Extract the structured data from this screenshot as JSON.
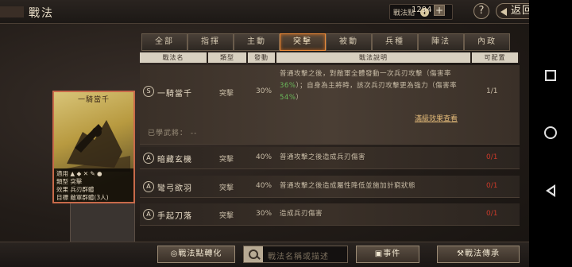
{
  "header": {
    "title": "戰法",
    "points_label": "戰法點",
    "points_icon": "coin-icon",
    "points_value": "1294",
    "plus_label": "+",
    "help_label": "?",
    "back_label": "返回"
  },
  "tabs": [
    {
      "label": "全部",
      "active": false
    },
    {
      "label": "指揮",
      "active": false
    },
    {
      "label": "主動",
      "active": false
    },
    {
      "label": "突擊",
      "active": true
    },
    {
      "label": "被動",
      "active": false
    },
    {
      "label": "兵種",
      "active": false
    },
    {
      "label": "陣法",
      "active": false
    },
    {
      "label": "內政",
      "active": false
    }
  ],
  "columns": [
    "戰法名",
    "類型",
    "發動",
    "戰法說明",
    "可配置"
  ],
  "featured": {
    "grade": "S",
    "name": "一騎當千",
    "type": "突擊",
    "rate": "30%",
    "desc_part1": "普通攻擊之後，對敵軍全體發動一次兵刃攻擊（傷害率",
    "desc_hl1": "36%",
    "desc_part2": "）；自身為主將時，該次兵刃攻擊更為強力（傷害率",
    "desc_hl2": "54%",
    "desc_part3": "）",
    "avail": "1/1",
    "effect_link": "滿級效果查看",
    "learned": "已學武將： --"
  },
  "rows": [
    {
      "grade": "A",
      "name": "暗藏玄機",
      "type": "突擊",
      "rate": "40%",
      "desc": "普通攻擊之後造成兵刃傷害",
      "avail": "0/1"
    },
    {
      "grade": "A",
      "name": "彎弓欲羽",
      "type": "突擊",
      "rate": "40%",
      "desc": "普通攻擊之後造成屬性降低並施加計窮狀態",
      "avail": "0/1"
    },
    {
      "grade": "A",
      "name": "手起刀落",
      "type": "突擊",
      "rate": "30%",
      "desc": "造成兵刃傷害",
      "avail": "0/1"
    }
  ],
  "card": {
    "title": "一騎當千",
    "line1_label": "適用",
    "line2_label": "類型",
    "line2_value": "突擊",
    "line3_label": "效果",
    "line3_value": "兵刃群體",
    "line4_label": "目標",
    "line4_value": "敵軍群體(3人)"
  },
  "bottom": {
    "convert_label": "戰法點轉化",
    "search_placeholder": "戰法名稱或描述",
    "event_label": "事件",
    "inherit_label": "戰法傳承"
  },
  "colors": {
    "accent": "#e88a3a",
    "highlight": "#6ab85a",
    "unavailable": "#c83a2a"
  }
}
